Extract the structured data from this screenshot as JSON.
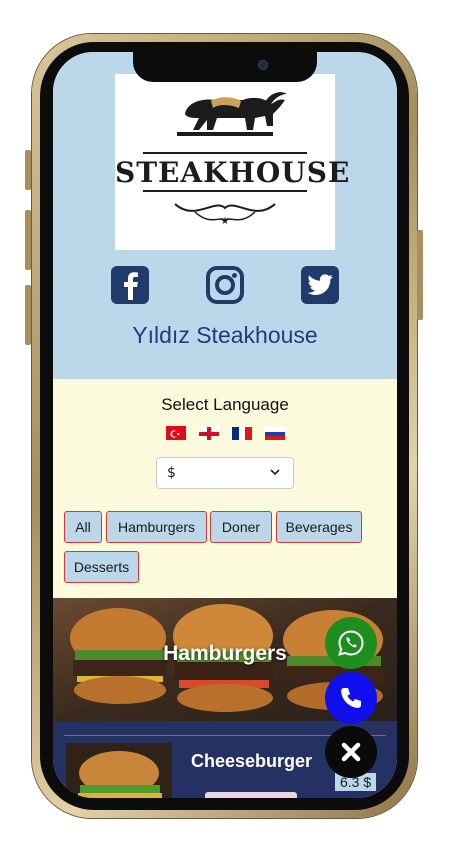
{
  "header": {
    "logo_text": "STEAKHOUSE",
    "restaurant_name": "Yıldız Steakhouse",
    "social": [
      "facebook-icon",
      "instagram-icon",
      "twitter-icon"
    ]
  },
  "language": {
    "label": "Select Language",
    "flags": [
      "turkey",
      "england",
      "france",
      "russia"
    ]
  },
  "currency": {
    "selected": "$"
  },
  "categories": [
    "All",
    "Hamburgers",
    "Doner",
    "Beverages",
    "Desserts"
  ],
  "section": {
    "title": "Hamburgers"
  },
  "product": {
    "name": "Cheeseburger",
    "price": "6.3 $"
  },
  "colors": {
    "header_bg": "#bcd7ea",
    "lang_bg": "#fcfadc",
    "accent": "#1f3d7a",
    "product_bg": "#263163",
    "whatsapp": "#1e8f1e",
    "call": "#1010ee",
    "close": "#0a0a0a"
  },
  "fabs": [
    "whatsapp-icon",
    "phone-icon",
    "close-icon"
  ]
}
